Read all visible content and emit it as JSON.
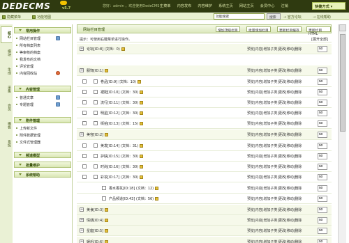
{
  "header": {
    "logo": "DEDECMS",
    "version": "v5.7",
    "welcome": "您好：admin ，欢迎使用DedeCMS！",
    "nav": [
      "主菜单",
      "内容发布",
      "内容维护",
      "系统主页",
      "网站主页",
      "会员中心",
      "注销"
    ],
    "quick": "快捷方式"
  },
  "toolbar": {
    "hide_menu": "隐藏菜单",
    "func_map": "功能地图",
    "search_value": "功能搜索",
    "search_btn": "搜索",
    "official": "官方论坛",
    "online_help": "在线帮助"
  },
  "vtabs": [
    "核心",
    "模块",
    "生成",
    "采集",
    "会员",
    "模板",
    "系统"
  ],
  "menu": {
    "sections": [
      {
        "title": "常用操作",
        "items": [
          "网站栏目管理",
          "所有档案列表",
          "等审核的档案",
          "我发布的文档",
          "评论管理",
          "内容回收站"
        ]
      },
      {
        "title": "内容管理",
        "items": [
          "普通文章",
          "专题管理"
        ]
      },
      {
        "title": "附件管理",
        "items": [
          "上传新文件",
          "附件数据管理",
          "文件式管理器"
        ]
      },
      {
        "title": "频道模型",
        "items": []
      },
      {
        "title": "批量维护",
        "items": []
      },
      {
        "title": "系统帮助",
        "items": []
      }
    ]
  },
  "main": {
    "title": "网站栏目管理",
    "buttons": [
      "增加顶级栏目",
      "批量增加栏目",
      "更新栏目缓存",
      "更新栏目HTML"
    ],
    "tip": "提示：可使用右键菜单进行操作。",
    "expand_all": "[展开全部]",
    "ops": "预览|内容|增加子类|更改|移动|删除",
    "order_default": "50",
    "rows": [
      {
        "level": 0,
        "name": "论坛[ID:8] (文档：0)"
      },
      {
        "level": 0,
        "name": "服饰[ID:1]"
      },
      {
        "level": 1,
        "name": "卷品[ID:9] (文档：10)"
      },
      {
        "level": 1,
        "name": "裙配[ID:10] (文档：30)"
      },
      {
        "level": 1,
        "name": "流行[ID:11] (文档：30)"
      },
      {
        "level": 1,
        "name": "明星[ID:12] (文档：30)"
      },
      {
        "level": 1,
        "name": "街拍[ID:13] (文档：15)"
      },
      {
        "level": 0,
        "name": "美容[ID:2]"
      },
      {
        "level": 1,
        "name": "美发[ID:14] (文档：31)"
      },
      {
        "level": 1,
        "name": "护肤[ID:15] (文档：30)"
      },
      {
        "level": 1,
        "name": "时尚[ID:16] (文档：30)"
      },
      {
        "level": 1,
        "name": "彩妆[ID:17] (文档：30)"
      },
      {
        "level": 2,
        "name": "香水香氛[ID:18] (文档：12)"
      },
      {
        "level": 2,
        "name": "产品频道[ID:43] (文档：56)"
      },
      {
        "level": 0,
        "name": "美食[ID:3]"
      },
      {
        "level": 0,
        "name": "情感[ID:4]"
      },
      {
        "level": 0,
        "name": "星座[ID:5]"
      },
      {
        "level": 0,
        "name": "娱乐[ID:6]"
      }
    ]
  }
}
